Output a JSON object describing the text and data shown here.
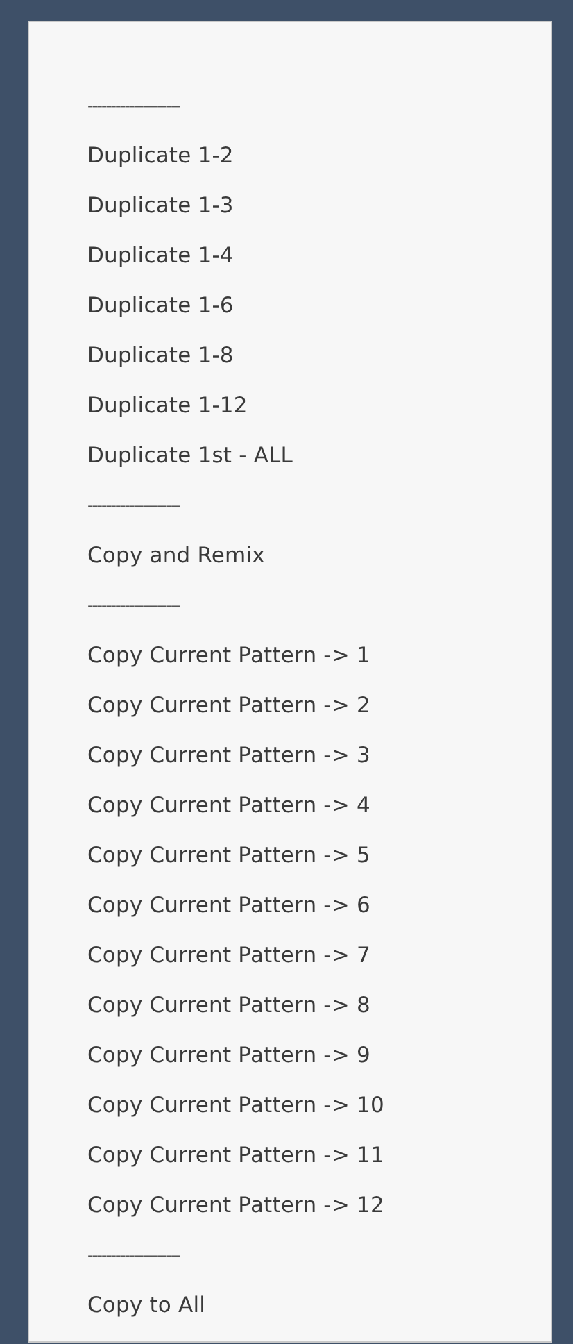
{
  "menu": {
    "items": [
      {
        "kind": "separator",
        "label": "--------------------"
      },
      {
        "kind": "item",
        "label": "Duplicate 1-2"
      },
      {
        "kind": "item",
        "label": "Duplicate 1-3"
      },
      {
        "kind": "item",
        "label": "Duplicate 1-4"
      },
      {
        "kind": "item",
        "label": "Duplicate 1-6"
      },
      {
        "kind": "item",
        "label": "Duplicate 1-8"
      },
      {
        "kind": "item",
        "label": "Duplicate 1-12"
      },
      {
        "kind": "item",
        "label": "Duplicate 1st - ALL"
      },
      {
        "kind": "separator",
        "label": "--------------------"
      },
      {
        "kind": "item",
        "label": "Copy and Remix"
      },
      {
        "kind": "separator",
        "label": "--------------------"
      },
      {
        "kind": "item",
        "label": "Copy Current Pattern -> 1"
      },
      {
        "kind": "item",
        "label": "Copy Current Pattern -> 2"
      },
      {
        "kind": "item",
        "label": "Copy Current Pattern -> 3"
      },
      {
        "kind": "item",
        "label": "Copy Current Pattern -> 4"
      },
      {
        "kind": "item",
        "label": "Copy Current Pattern -> 5"
      },
      {
        "kind": "item",
        "label": "Copy Current Pattern -> 6"
      },
      {
        "kind": "item",
        "label": "Copy Current Pattern -> 7"
      },
      {
        "kind": "item",
        "label": "Copy Current Pattern -> 8"
      },
      {
        "kind": "item",
        "label": "Copy Current Pattern -> 9"
      },
      {
        "kind": "item",
        "label": "Copy Current Pattern -> 10"
      },
      {
        "kind": "item",
        "label": "Copy Current Pattern -> 11"
      },
      {
        "kind": "item",
        "label": "Copy Current Pattern -> 12"
      },
      {
        "kind": "separator",
        "label": "--------------------"
      },
      {
        "kind": "item",
        "label": "Copy to All"
      }
    ]
  }
}
